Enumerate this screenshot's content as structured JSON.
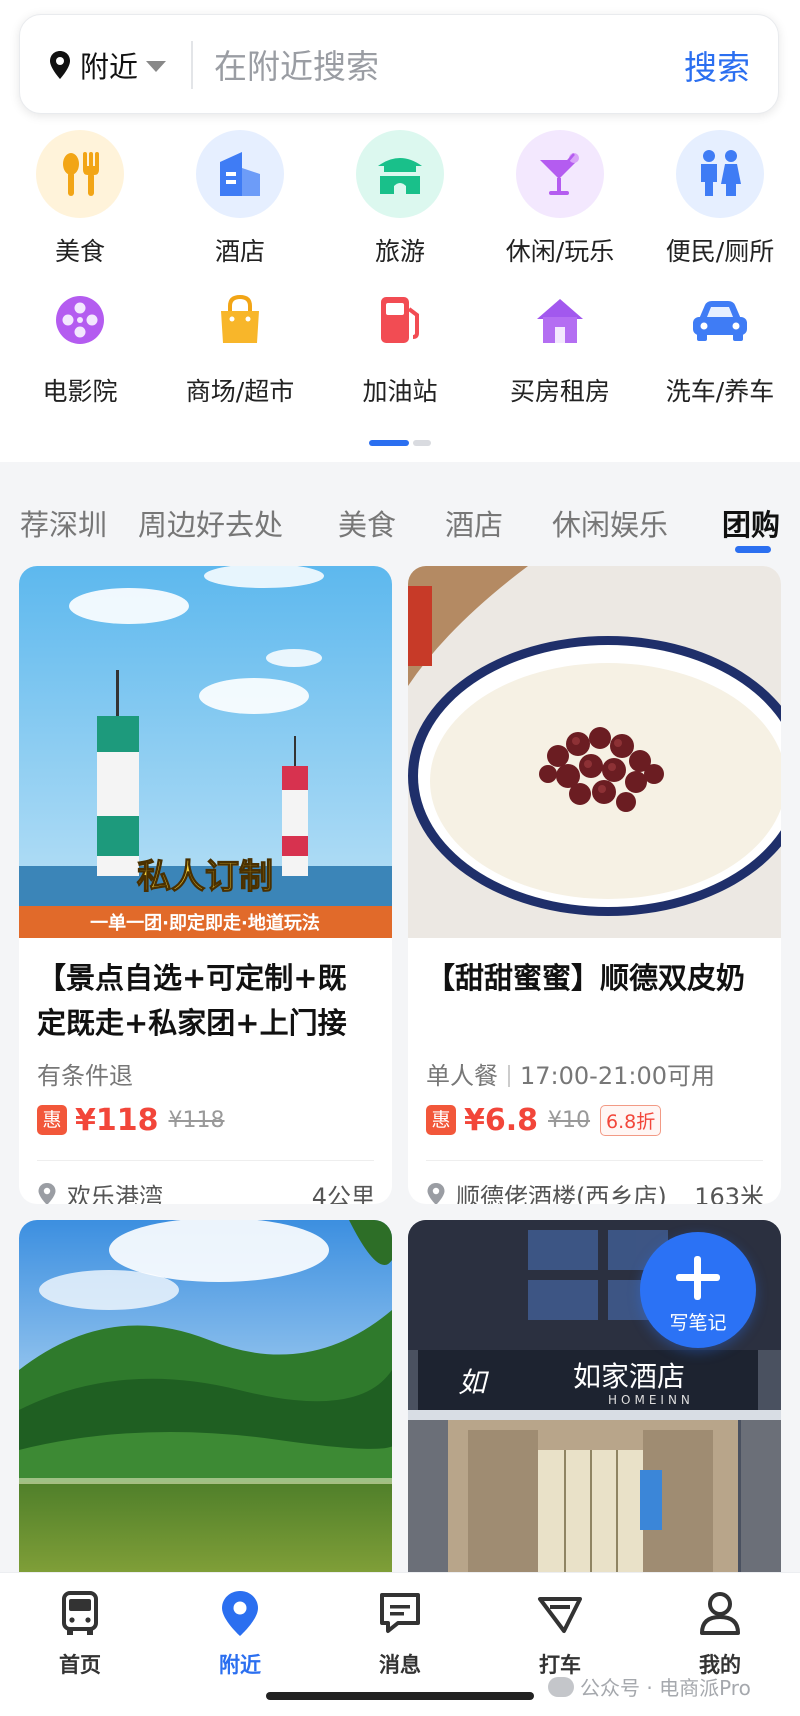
{
  "search": {
    "location_label": "附近",
    "placeholder": "在附近搜索",
    "button_label": "搜索"
  },
  "categories": [
    {
      "label": "美食",
      "icon": "fork-spoon-icon"
    },
    {
      "label": "酒店",
      "icon": "hotel-building-icon"
    },
    {
      "label": "旅游",
      "icon": "pavilion-icon"
    },
    {
      "label": "休闲/玩乐",
      "icon": "cocktail-icon"
    },
    {
      "label": "便民/厕所",
      "icon": "restroom-icon"
    },
    {
      "label": "电影院",
      "icon": "film-reel-icon"
    },
    {
      "label": "商场/超市",
      "icon": "shopping-bag-icon"
    },
    {
      "label": "加油站",
      "icon": "fuel-pump-icon"
    },
    {
      "label": "买房租房",
      "icon": "house-icon"
    },
    {
      "label": "洗车/养车",
      "icon": "car-icon"
    }
  ],
  "tabs": [
    {
      "label": "荐深圳"
    },
    {
      "label": "周边好去处"
    },
    {
      "label": "美食"
    },
    {
      "label": "酒店"
    },
    {
      "label": "休闲娱乐"
    },
    {
      "label": "团购",
      "active": true
    }
  ],
  "cards": [
    {
      "title": "【景点自选+可定制+既定既走+私家团+上门接送】",
      "image_banner_big": "私人订制",
      "image_banner_small": "一单一团·即定即走·地道玩法",
      "subtitle": "有条件退",
      "badge": "惠",
      "price": "¥118",
      "original_price": "¥118",
      "location": "欢乐港湾",
      "distance": "4公里"
    },
    {
      "title": "【甜甜蜜蜜】顺德双皮奶",
      "subtitle_meal": "单人餐",
      "subtitle_time": "17:00-21:00可用",
      "badge": "惠",
      "price": "¥6.8",
      "original_price": "¥10",
      "discount": "6.8折",
      "location": "顺德佬酒楼(西乡店)",
      "distance": "163米"
    },
    {
      "title": ""
    },
    {
      "title": "",
      "sign_cn": "如家酒店",
      "sign_en": "HOMEINN",
      "sign_logo": "如"
    }
  ],
  "fab": {
    "label": "写笔记"
  },
  "bottom_nav": [
    {
      "label": "首页",
      "icon": "bus-icon"
    },
    {
      "label": "附近",
      "icon": "location-pin-icon",
      "active": true
    },
    {
      "label": "消息",
      "icon": "message-icon"
    },
    {
      "label": "打车",
      "icon": "taxi-icon"
    },
    {
      "label": "我的",
      "icon": "user-icon"
    }
  ],
  "watermark": "公众号 · 电商派Pro",
  "colors": {
    "accent": "#2b6ff0",
    "price": "#f2463a",
    "badge": "#f2573a"
  }
}
